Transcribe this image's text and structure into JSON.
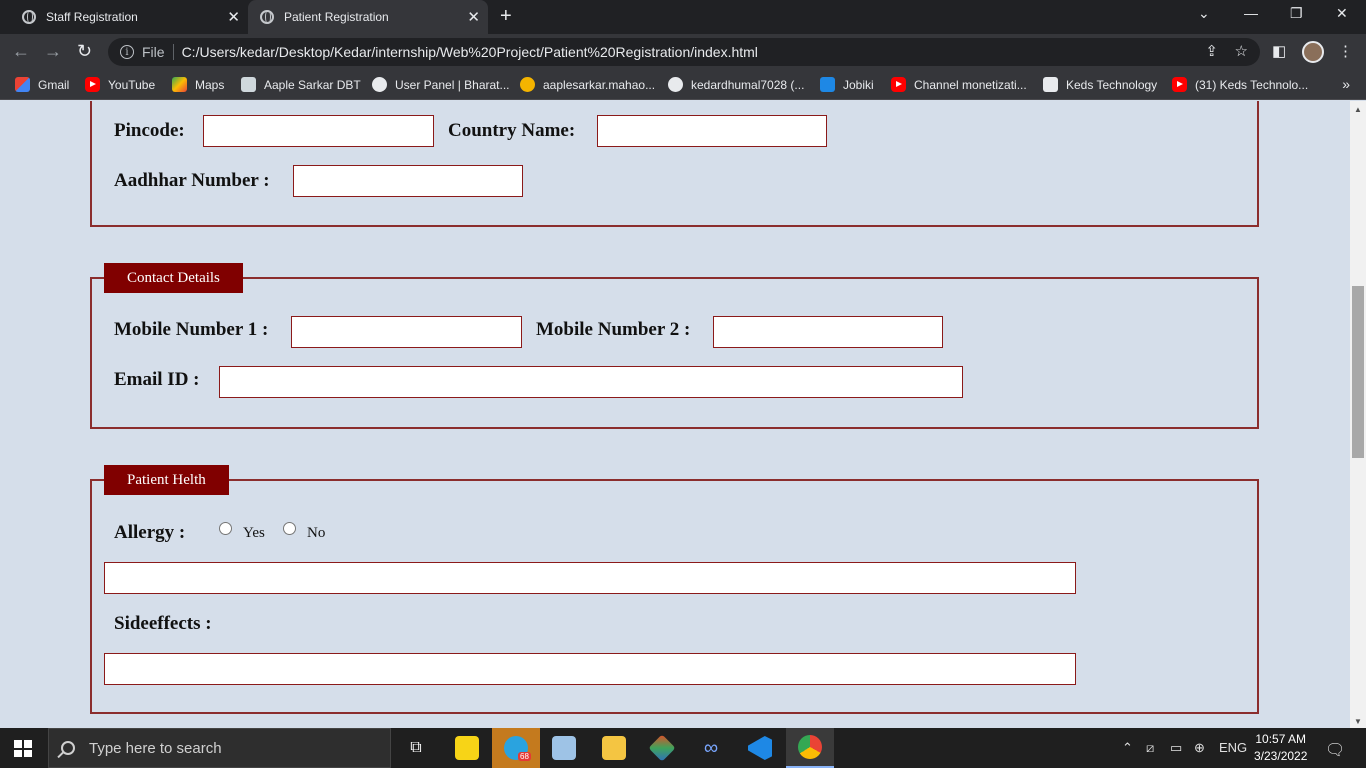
{
  "browser": {
    "tabs": [
      {
        "title": "Staff Registration",
        "active": false
      },
      {
        "title": "Patient Registration",
        "active": true
      }
    ],
    "address": {
      "scheme_label": "File",
      "url": "C:/Users/kedar/Desktop/Kedar/internship/Web%20Project/Patient%20Registration/index.html"
    },
    "bookmarks": [
      {
        "label": "Gmail",
        "icon": "gmail-icon"
      },
      {
        "label": "YouTube",
        "icon": "youtube-icon"
      },
      {
        "label": "Maps",
        "icon": "maps-icon"
      },
      {
        "label": "Aaple Sarkar DBT",
        "icon": "document-icon"
      },
      {
        "label": "User Panel | Bharat...",
        "icon": "seal-icon"
      },
      {
        "label": "aaplesarkar.mahao...",
        "icon": "sun-icon"
      },
      {
        "label": "kedardhumal7028 (...",
        "icon": "github-icon"
      },
      {
        "label": "Jobiki",
        "icon": "jobiki-icon"
      },
      {
        "label": "Channel monetizati...",
        "icon": "youtube-icon"
      },
      {
        "label": "Keds Technology",
        "icon": "keds-icon"
      },
      {
        "label": "(31) Keds Technolo...",
        "icon": "youtube-icon"
      }
    ]
  },
  "form": {
    "address_section": {
      "pincode_label": "Pincode:",
      "country_label": "Country Name:",
      "aadhhar_label": "Aadhhar Number :"
    },
    "contact_section": {
      "legend": "Contact Details",
      "mobile1_label": "Mobile Number 1 :",
      "mobile2_label": "Mobile Number 2 :",
      "email_label": "Email ID :"
    },
    "health_section": {
      "legend": "Patient Helth",
      "allergy_label": "Allergy :",
      "allergy_options": [
        "Yes",
        "No"
      ],
      "sideeffects_label": "Sideeffects :"
    }
  },
  "taskbar": {
    "search_placeholder": "Type here to search",
    "telegram_badge": "68",
    "language": "ENG",
    "time": "10:57 AM",
    "date": "3/23/2022"
  },
  "colors": {
    "page_background": "#d5deea",
    "section_border": "#8b2d2d",
    "legend_background": "#800000"
  }
}
